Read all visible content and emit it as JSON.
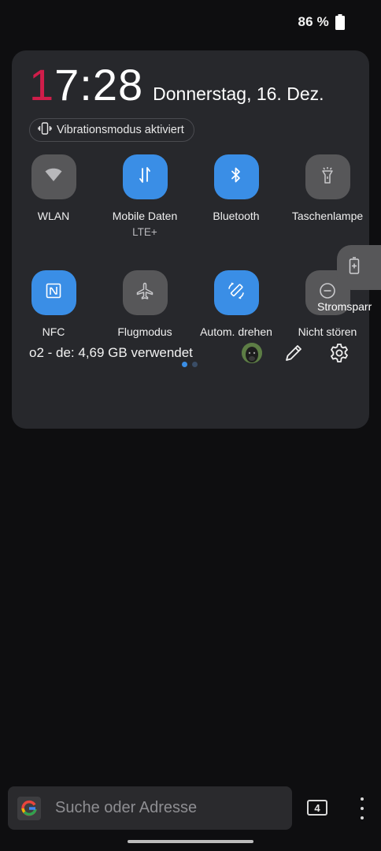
{
  "status_bar": {
    "battery_percent": "86 %"
  },
  "panel": {
    "clock_first_digit": "1",
    "clock_rest": "7:28",
    "date": "Donnerstag, 16. Dez.",
    "vibration_pill": "Vibrationsmodus aktiviert",
    "tiles": [
      {
        "label": "WLAN",
        "sub": "",
        "state": "off",
        "icon": "wifi-icon"
      },
      {
        "label": "Mobile Daten",
        "sub": "LTE+",
        "state": "on",
        "icon": "mobile-data-icon"
      },
      {
        "label": "Bluetooth",
        "sub": "",
        "state": "on",
        "icon": "bluetooth-icon"
      },
      {
        "label": "Taschenlampe",
        "sub": "",
        "state": "off",
        "icon": "flashlight-icon"
      },
      {
        "label": "NFC",
        "sub": "",
        "state": "on",
        "icon": "nfc-icon"
      },
      {
        "label": "Flugmodus",
        "sub": "",
        "state": "off",
        "icon": "airplane-icon"
      },
      {
        "label": "Autom. drehen",
        "sub": "",
        "state": "on",
        "icon": "auto-rotate-icon"
      },
      {
        "label": "Nicht stören",
        "sub": "",
        "state": "off",
        "icon": "do-not-disturb-icon"
      }
    ],
    "dragging_tile": {
      "label": "Stromsparr",
      "icon": "battery-saver-icon"
    },
    "data_usage": "o2 - de: 4,69 GB verwendet",
    "page_count": 2,
    "active_page": 1
  },
  "browser_bar": {
    "search_placeholder": "Suche oder Adresse",
    "tab_count": "4"
  },
  "colors": {
    "accent": "#3a8ee6",
    "tile_off": "#575759",
    "panel_bg": "#27282c",
    "clock_accent": "#d01d4a"
  }
}
